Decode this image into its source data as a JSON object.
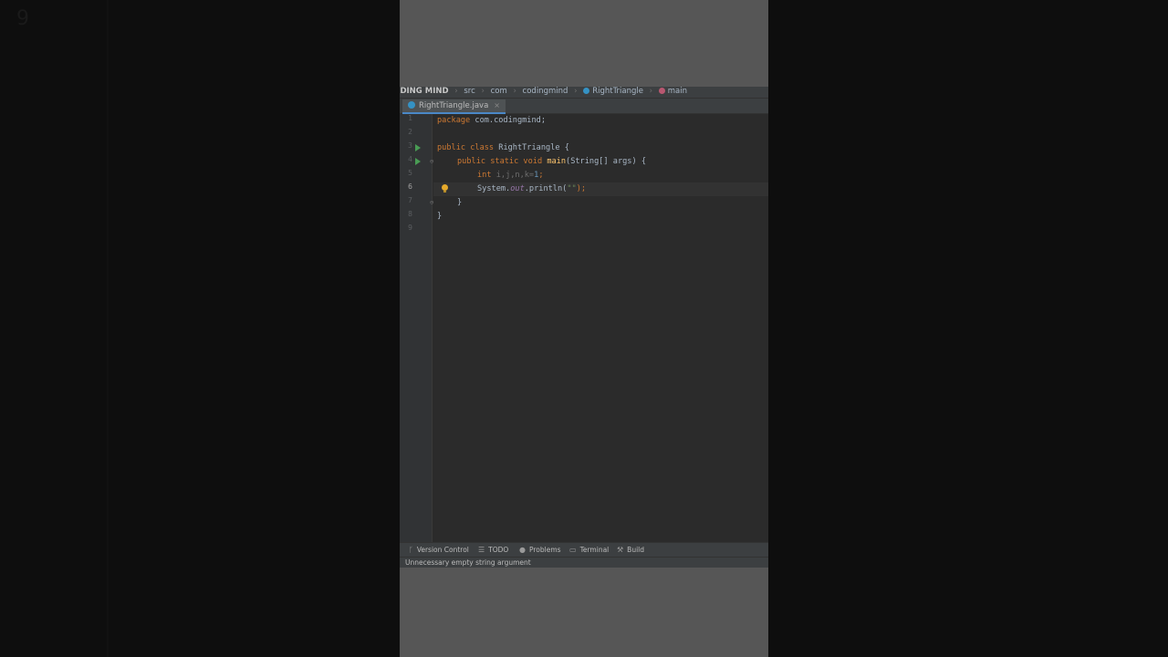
{
  "background": {
    "left_faint_text": "9"
  },
  "breadcrumb": {
    "project": "CODING MIND",
    "items": [
      "src",
      "com",
      "codingmind",
      "RightTriangle",
      "main"
    ]
  },
  "tab": {
    "label": "RightTriangle.java",
    "close": "×"
  },
  "gutter": {
    "line_numbers": [
      "1",
      "2",
      "3",
      "4",
      "5",
      "6",
      "7",
      "8",
      "9"
    ],
    "current_line": "6"
  },
  "code": {
    "line1": {
      "kw": "package",
      "rest": " com.codingmind;"
    },
    "line3": {
      "kw": "public class",
      "name": " RightTriangle {"
    },
    "line4": {
      "kw": "public static void",
      "fn": "main",
      "rest": "(String[] args) {"
    },
    "line5": {
      "kw": "int",
      "vars": "i,j,n,k=",
      "num": "1",
      "end": ";"
    },
    "line6": {
      "pre": "System.",
      "fld": "out",
      "mid": ".println(",
      "str": "\"\"",
      "end": ");"
    },
    "line7": "}",
    "line8": "}"
  },
  "toolwindows": [
    {
      "label": "Version Control",
      "icon": "branch-icon"
    },
    {
      "label": "TODO",
      "icon": "list-icon"
    },
    {
      "label": "Problems",
      "icon": "warning-icon"
    },
    {
      "label": "Terminal",
      "icon": "terminal-icon"
    },
    {
      "label": "Build",
      "icon": "hammer-icon"
    }
  ],
  "status": {
    "message": "Unnecessary empty string argument"
  },
  "colors": {
    "accent": "#4a88c7",
    "keyword": "#cc7832",
    "function": "#ffc66d",
    "string": "#6a8759",
    "run": "#499c54",
    "bulb": "#e5a92b"
  }
}
